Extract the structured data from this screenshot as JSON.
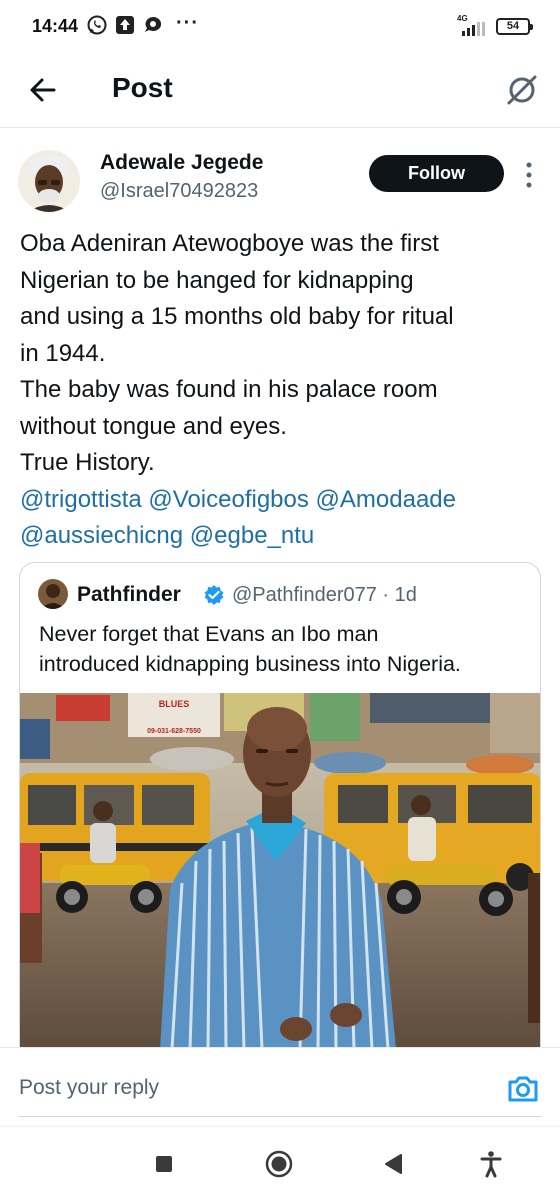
{
  "status_bar": {
    "time": "14:44",
    "network_type": "4G",
    "battery": "54",
    "overflow_dots": "···"
  },
  "header": {
    "title": "Post"
  },
  "post": {
    "author_name": "Adewale Jegede",
    "author_handle": "@Israel70492823",
    "follow_label": "Follow",
    "text_lines": [
      "Oba Adeniran Atewogboye was the first",
      "Nigerian to be hanged for kidnapping",
      "and using a 15 months old baby for ritual",
      "in 1944.",
      "The baby was found in his palace room",
      "without  tongue and eyes.",
      "True History."
    ],
    "mention_lines": [
      "@trigottista @Voiceofigbos @Amodaade",
      "@aussiechicng @egbe_ntu"
    ]
  },
  "quoted_post": {
    "author_name": "Pathfinder",
    "verified": true,
    "handle_time": "@Pathfinder077 · 1d",
    "text_lines": [
      "Never forget that Evans an Ibo man",
      "introduced kidnapping business into Nigeria."
    ],
    "image_signs": [
      "BLUES",
      "09-031-628-7550"
    ]
  },
  "reply_bar": {
    "placeholder": "Post your reply"
  },
  "colors": {
    "mention": "#1d6fa5",
    "follow_bg": "#0f1419",
    "secondary_text": "#536471",
    "accent": "#1d9bf0"
  },
  "icons": [
    "whatsapp-icon",
    "upload-icon",
    "chat-bubble-icon",
    "back-arrow-icon",
    "grok-icon",
    "more-vertical-icon",
    "verified-badge-icon",
    "camera-icon",
    "nav-square-icon",
    "nav-circle-icon",
    "nav-back-triangle-icon",
    "accessibility-icon"
  ]
}
